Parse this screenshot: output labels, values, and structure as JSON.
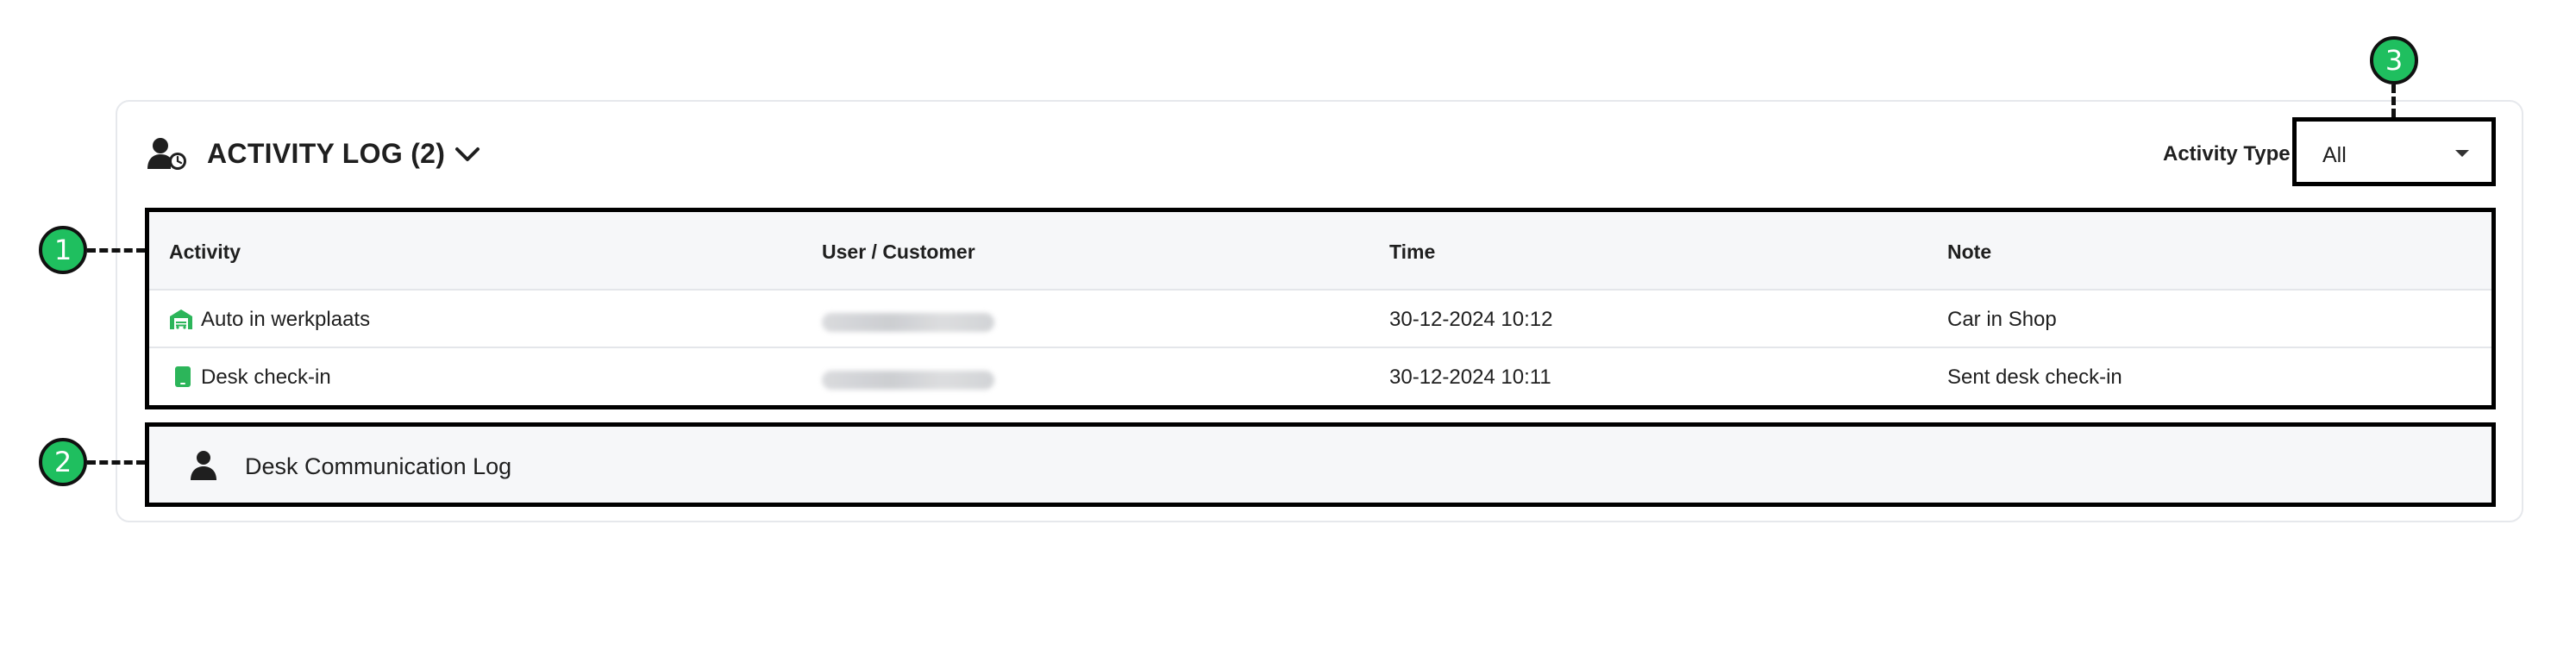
{
  "header": {
    "title": "ACTIVITY LOG (2)",
    "icon": "user-clock-icon",
    "toggle_icon": "chevron-down-icon"
  },
  "filter": {
    "label": "Activity Type",
    "selected": "All"
  },
  "table": {
    "columns": [
      "Activity",
      "User / Customer",
      "Time",
      "Note"
    ],
    "rows": [
      {
        "activity": "Auto in werkplaats",
        "icon": "garage-icon",
        "user": "",
        "time": "30-12-2024 10:12",
        "note": "Car in Shop"
      },
      {
        "activity": "Desk check-in",
        "icon": "tablet-icon",
        "user": "",
        "time": "30-12-2024 10:11",
        "note": "Sent desk check-in"
      }
    ]
  },
  "communication": {
    "label": "Desk Communication Log",
    "icon": "person-icon"
  },
  "callouts": [
    "1",
    "2",
    "3"
  ],
  "colors": {
    "accent_green": "#1fbf5f",
    "icon_green": "#2cb55a",
    "header_bg": "#f6f7f9",
    "highlight_border": "#000000"
  }
}
